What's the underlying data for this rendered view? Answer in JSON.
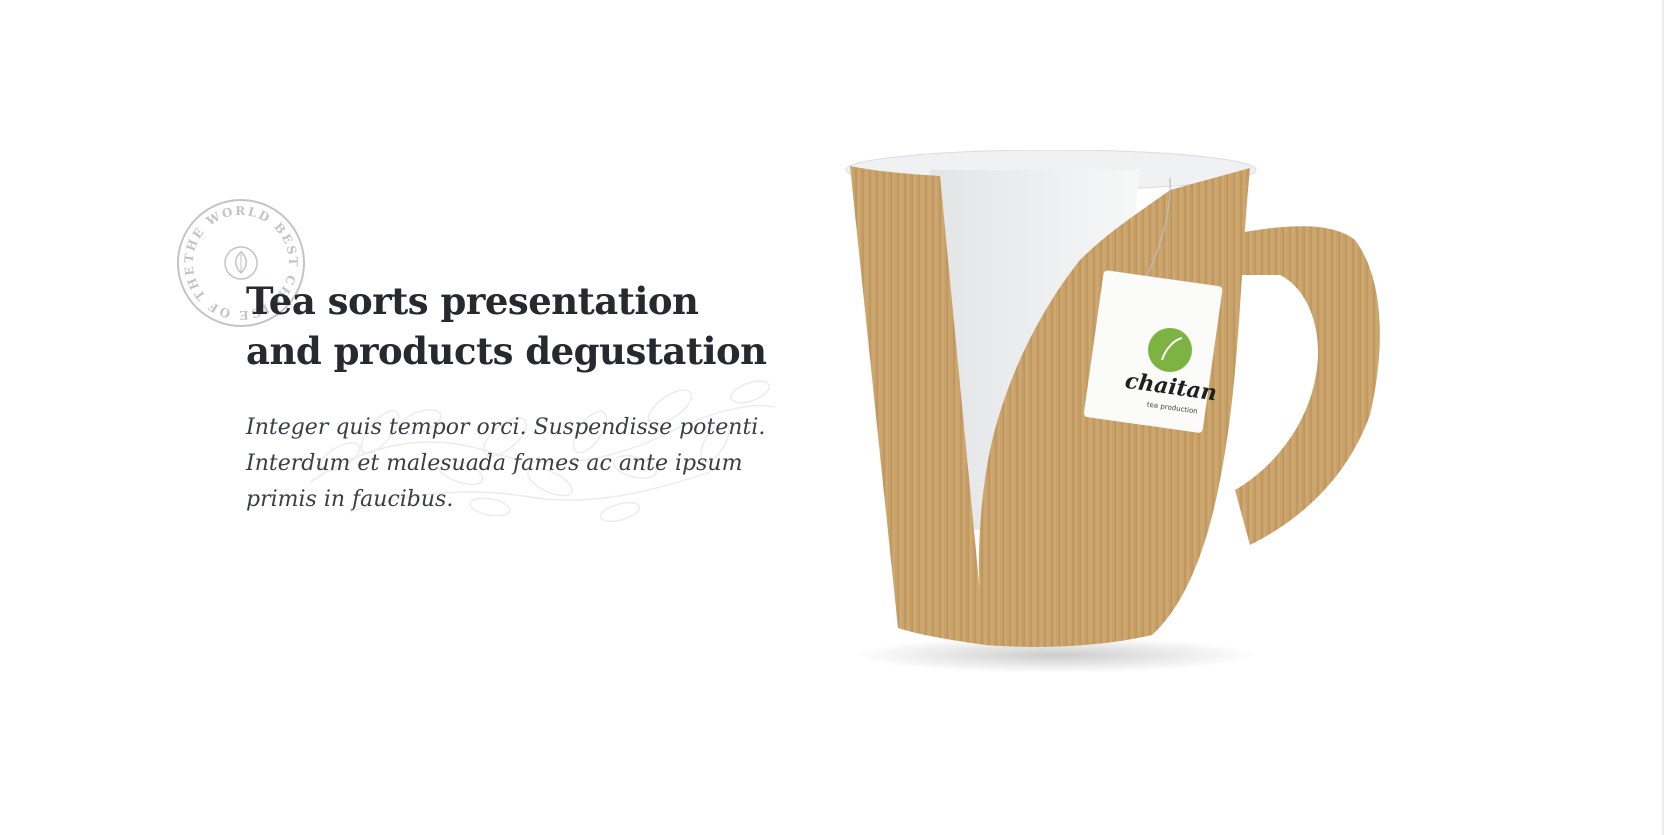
{
  "hero": {
    "heading_line1": "Tea sorts presentation",
    "heading_line2": "and products degustation",
    "body_line1": "Integer quis tempor orci. Suspendisse potenti.",
    "body_line2": "Interdum et malesuada fames ac ante ipsum",
    "body_line3": "primis in faucibus."
  },
  "stamp": {
    "text": "THE WORLD BEST CHOICE OF THE TEA",
    "icon": "tea-leaf-icon"
  },
  "product": {
    "tag_brand": "chaitan",
    "tag_sub": "tea production"
  },
  "colors": {
    "heading": "#262a2e",
    "body": "#3a3f44",
    "kraft": "#c9a26a",
    "tag_green": "#7cb342",
    "stamp_gray": "#c4c4c4"
  }
}
